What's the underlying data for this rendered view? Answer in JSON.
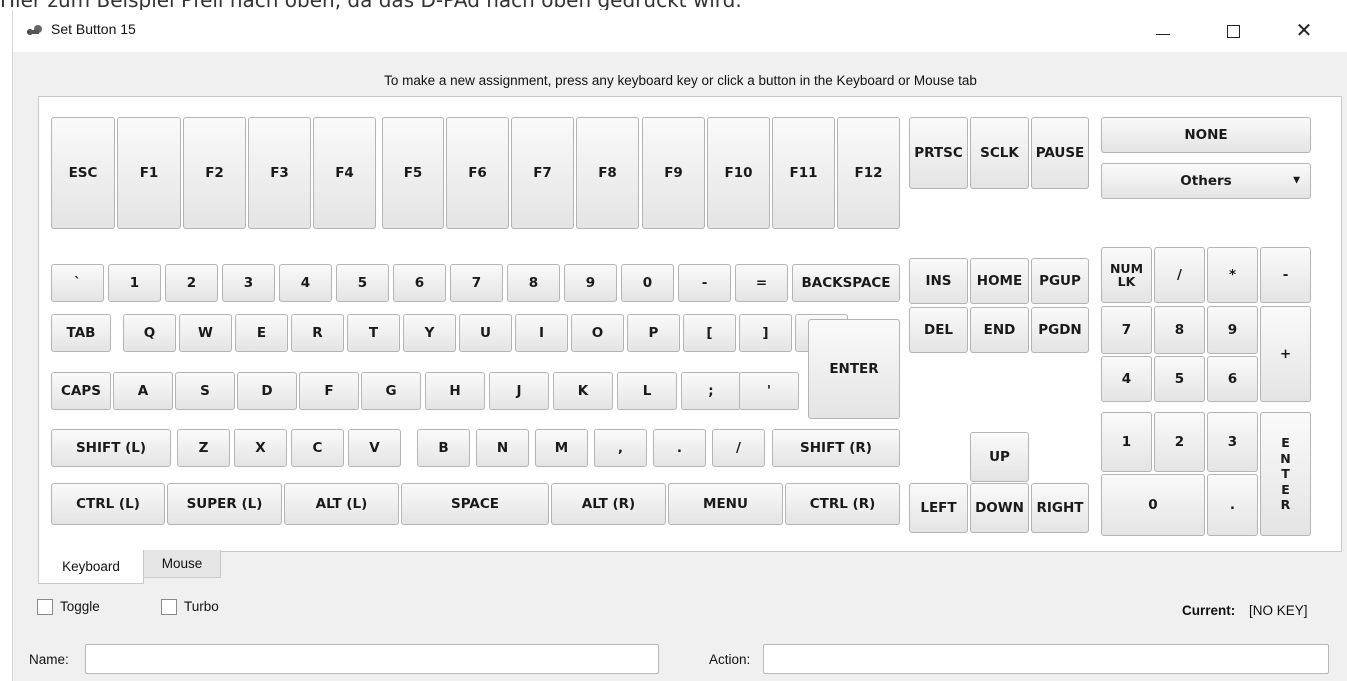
{
  "background_text": "Hier zum Beispiel Pfeil nach oben, da das D-PAd nach oben gedrückt wird.",
  "window": {
    "title": "Set Button 15",
    "controls": {
      "minimize": "–",
      "maximize": "☐",
      "close": "✕"
    }
  },
  "instruction": "To make a new assignment, press any keyboard key or click a button in the Keyboard or Mouse tab",
  "keys": {
    "esc": "ESC",
    "f1": "F1",
    "f2": "F2",
    "f3": "F3",
    "f4": "F4",
    "f5": "F5",
    "f6": "F6",
    "f7": "F7",
    "f8": "F8",
    "f9": "F9",
    "f10": "F10",
    "f11": "F11",
    "f12": "F12",
    "prtsc": "PRTSC",
    "sclk": "SCLK",
    "pause": "PAUSE",
    "backtick": "`",
    "k1": "1",
    "k2": "2",
    "k3": "3",
    "k4": "4",
    "k5": "5",
    "k6": "6",
    "k7": "7",
    "k8": "8",
    "k9": "9",
    "k0": "0",
    "minus": "-",
    "equals": "=",
    "backspace": "BACKSPACE",
    "tab": "TAB",
    "q": "Q",
    "w": "W",
    "e": "E",
    "r": "R",
    "t": "T",
    "y": "Y",
    "u": "U",
    "i": "I",
    "o": "O",
    "p": "P",
    "lbracket": "[",
    "rbracket": "]",
    "backslash": "\\",
    "enter": "ENTER",
    "caps": "CAPS",
    "a": "A",
    "s": "S",
    "d": "D",
    "f": "F",
    "g": "G",
    "h": "H",
    "j": "J",
    "k": "K",
    "l": "L",
    "semicolon": ";",
    "quote": "'",
    "shift_l": "SHIFT (L)",
    "z": "Z",
    "x": "X",
    "c": "C",
    "v": "V",
    "b": "B",
    "n": "N",
    "m": "M",
    "comma": ",",
    "period": ".",
    "slash": "/",
    "shift_r": "SHIFT (R)",
    "ctrl_l": "CTRL (L)",
    "super_l": "SUPER (L)",
    "alt_l": "ALT (L)",
    "space": "SPACE",
    "alt_r": "ALT (R)",
    "menu": "MENU",
    "ctrl_r": "CTRL (R)",
    "ins": "INS",
    "home": "HOME",
    "pgup": "PGUP",
    "del": "DEL",
    "end": "END",
    "pgdn": "PGDN",
    "up": "UP",
    "left": "LEFT",
    "down": "DOWN",
    "right": "RIGHT",
    "none": "NONE",
    "others": "Others",
    "others_arrow": "▼",
    "numlk": "NUM\nLK",
    "num_div": "/",
    "num_mul": "*",
    "num_sub": "-",
    "num7": "7",
    "num8": "8",
    "num9": "9",
    "num_add": "+",
    "num4": "4",
    "num5": "5",
    "num6": "6",
    "num1": "1",
    "num2": "2",
    "num3": "3",
    "num_enter": "E\nN\nT\nE\nR",
    "num0": "0",
    "num_dot": "."
  },
  "tabs": {
    "keyboard": "Keyboard",
    "mouse": "Mouse"
  },
  "options": {
    "toggle": "Toggle",
    "turbo": "Turbo"
  },
  "current": {
    "label": "Current:",
    "value": "[NO KEY]"
  },
  "fields": {
    "name_label": "Name:",
    "name_value": "",
    "action_label": "Action:",
    "action_value": ""
  }
}
